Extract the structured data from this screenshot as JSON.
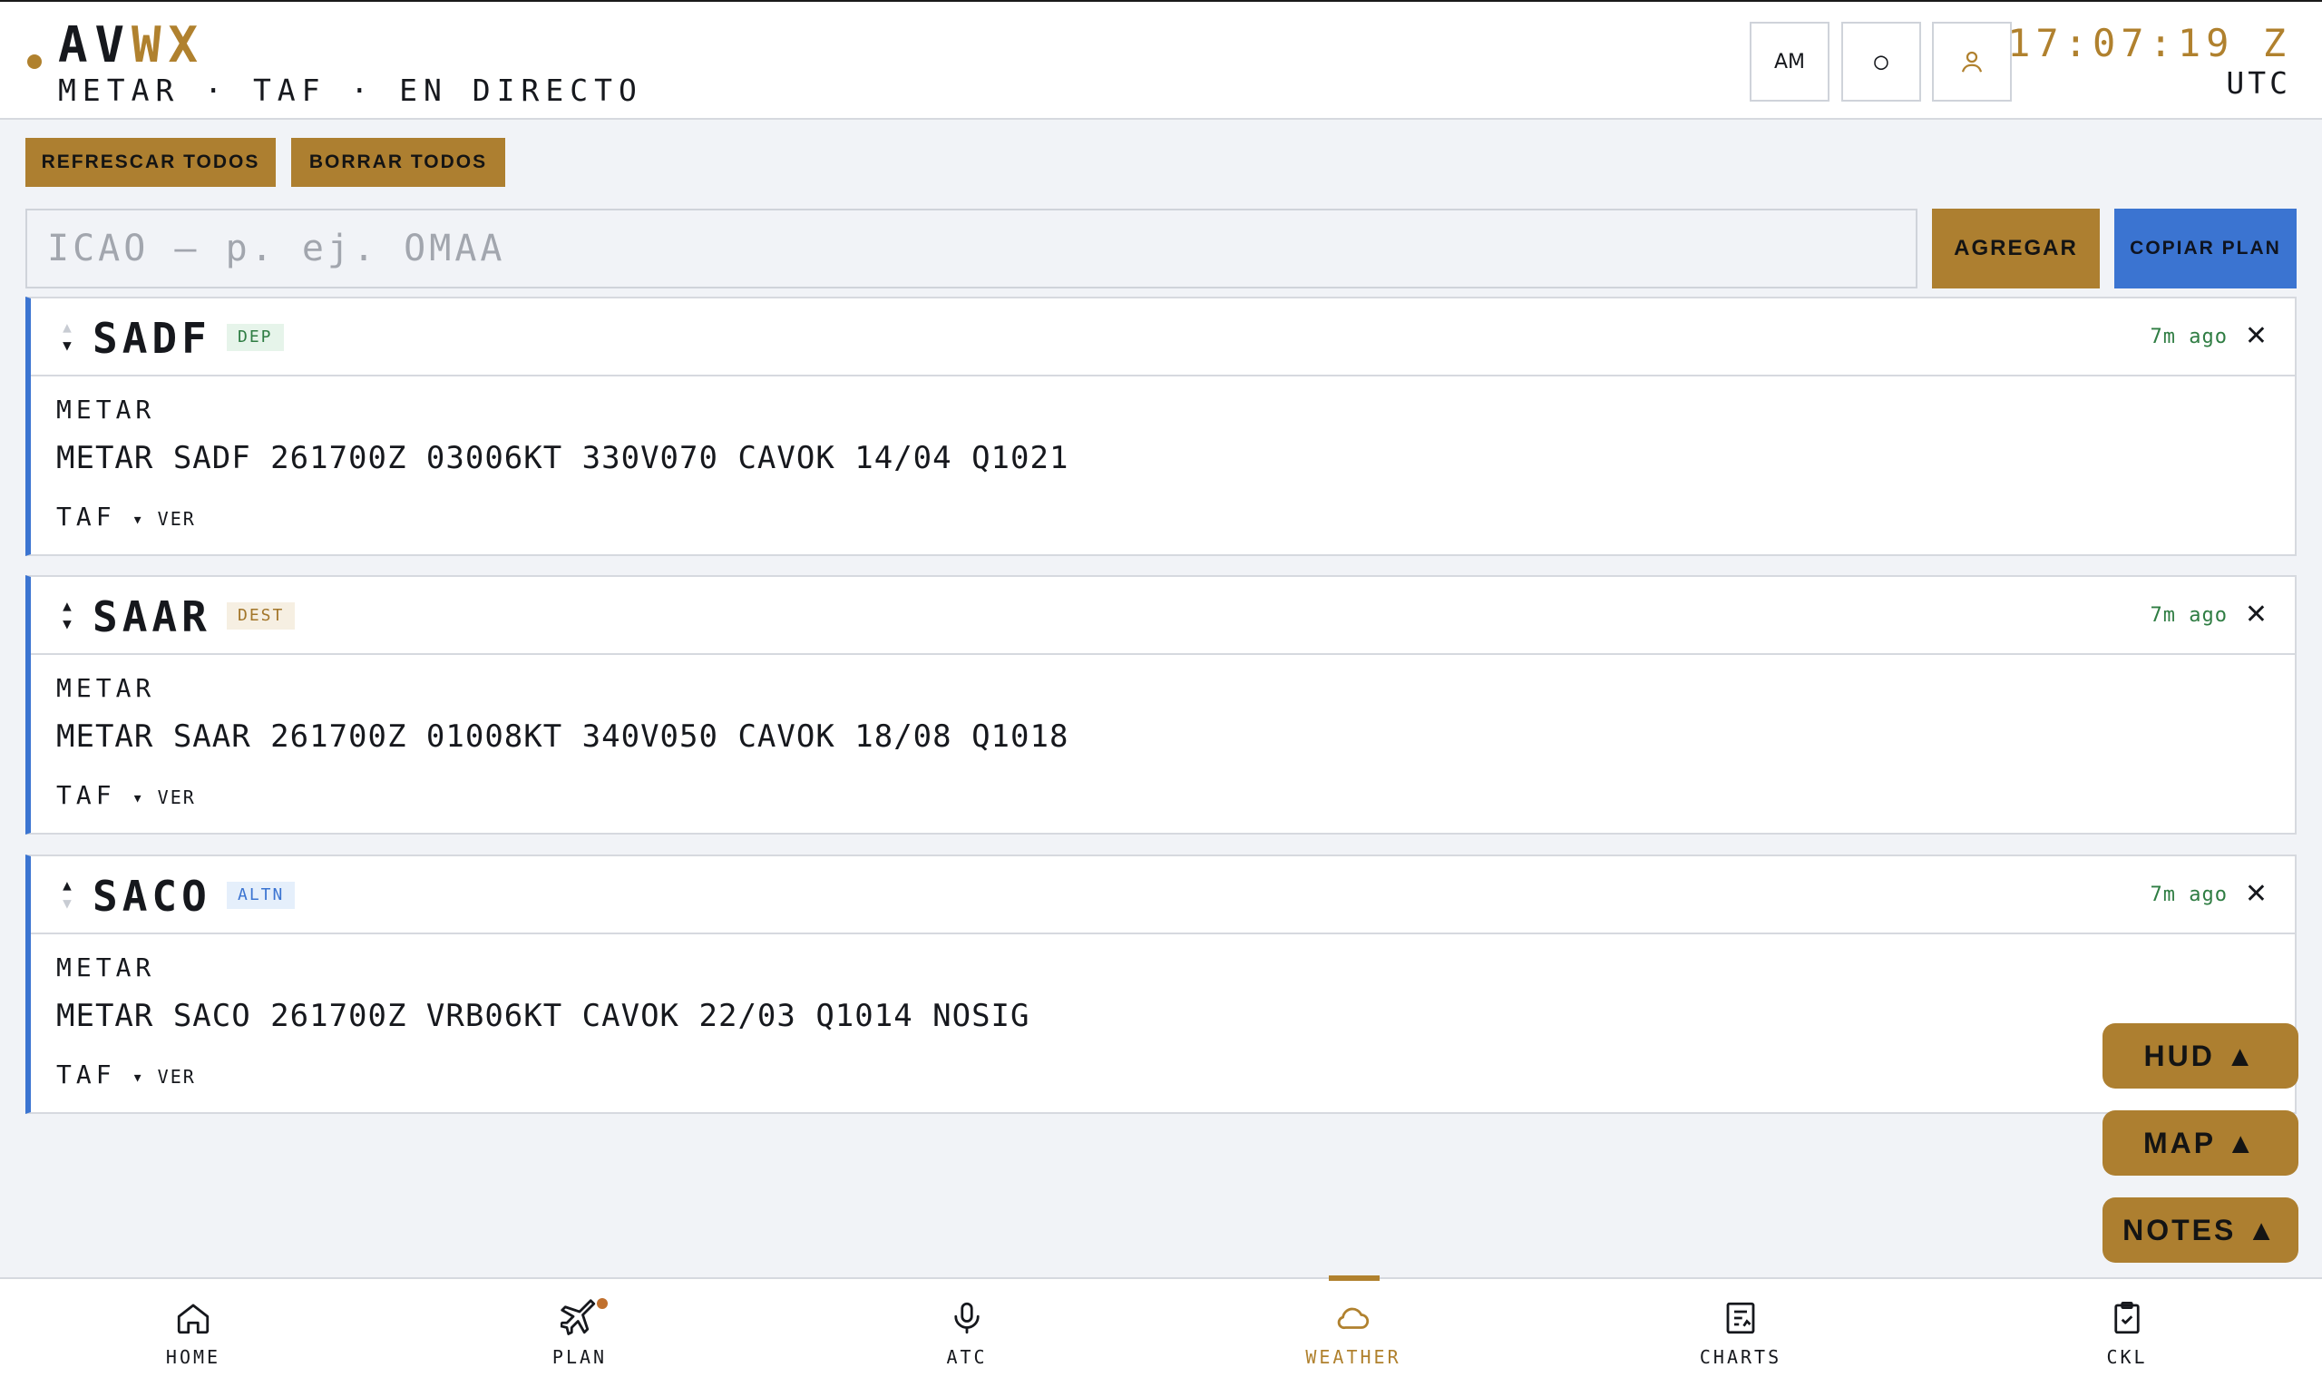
{
  "header": {
    "logo_av": "AV",
    "logo_wx": "WX",
    "subtitle": "METAR · TAF · EN DIRECTO",
    "btn_font": "AM",
    "btn_theme": "○",
    "clock": "17:07:19 Z",
    "clock_sub": "UTC"
  },
  "toolbar": {
    "refresh_label": "REFRESCAR TODOS",
    "clear_label": "BORRAR TODOS",
    "search_placeholder": "ICAO — p. ej. OMAA",
    "add_label": "AGREGAR",
    "copy_label": "COPIAR PLAN"
  },
  "stations": [
    {
      "icao": "SADF",
      "tag": "DEP",
      "ago": "7m ago",
      "metar_label": "METAR",
      "metar": "METAR SADF 261700Z 03006KT 330V070 CAVOK 14/04 Q1021",
      "taf_label": "TAF",
      "taf_toggle": "▾ VER"
    },
    {
      "icao": "SAAR",
      "tag": "DEST",
      "ago": "7m ago",
      "metar_label": "METAR",
      "metar": "METAR SAAR 261700Z 01008KT 340V050 CAVOK 18/08 Q1018",
      "taf_label": "TAF",
      "taf_toggle": "▾ VER"
    },
    {
      "icao": "SACO",
      "tag": "ALTN",
      "ago": "7m ago",
      "metar_label": "METAR",
      "metar": "METAR SACO 261700Z VRB06KT CAVOK 22/03 Q1014 NOSIG",
      "taf_label": "TAF",
      "taf_toggle": "▾ VER"
    }
  ],
  "floating": {
    "hud": "HUD ▲",
    "map": "MAP ▲",
    "notes": "NOTES ▲"
  },
  "nav": {
    "home": "HOME",
    "plan": "PLAN",
    "atc": "ATC",
    "weather": "WEATHER",
    "charts": "CHARTS",
    "ckl": "CKL"
  },
  "colors": {
    "accent": "#b0812e",
    "blue": "#3b74d1",
    "green": "#2f7d43"
  }
}
